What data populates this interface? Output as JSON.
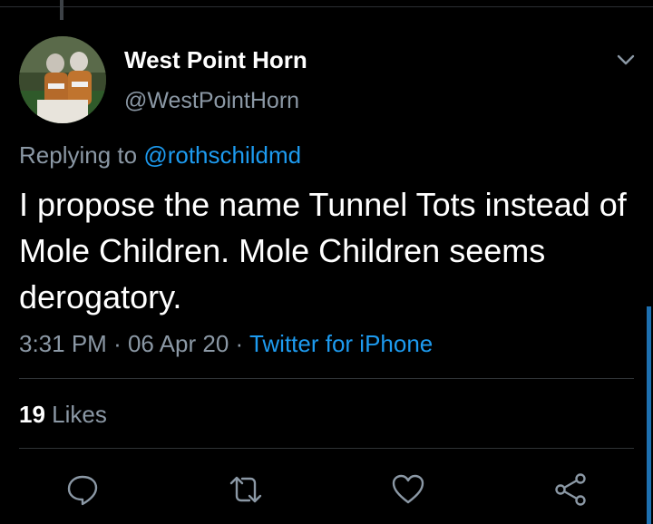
{
  "tweet": {
    "author": {
      "display_name": "West Point Horn",
      "handle": "@WestPointHorn"
    },
    "reply_prefix": "Replying to",
    "reply_to": "@rothschildmd",
    "text": "I propose the name Tunnel Tots instead of Mole Children. Mole Children seems derogatory.",
    "time": "3:31 PM",
    "separator": "·",
    "date": "06 Apr 20",
    "source": "Twitter for iPhone",
    "likes_count": "19",
    "likes_label": "Likes"
  },
  "actions": {
    "reply_icon": "reply-icon",
    "retweet_icon": "retweet-icon",
    "like_icon": "heart-icon",
    "share_icon": "share-icon",
    "menu_icon": "chevron-down-icon"
  },
  "colors": {
    "background": "#000000",
    "text": "#ffffff",
    "secondary": "#8b98a5",
    "accent": "#1d9bf0",
    "divider": "#2f3336"
  }
}
